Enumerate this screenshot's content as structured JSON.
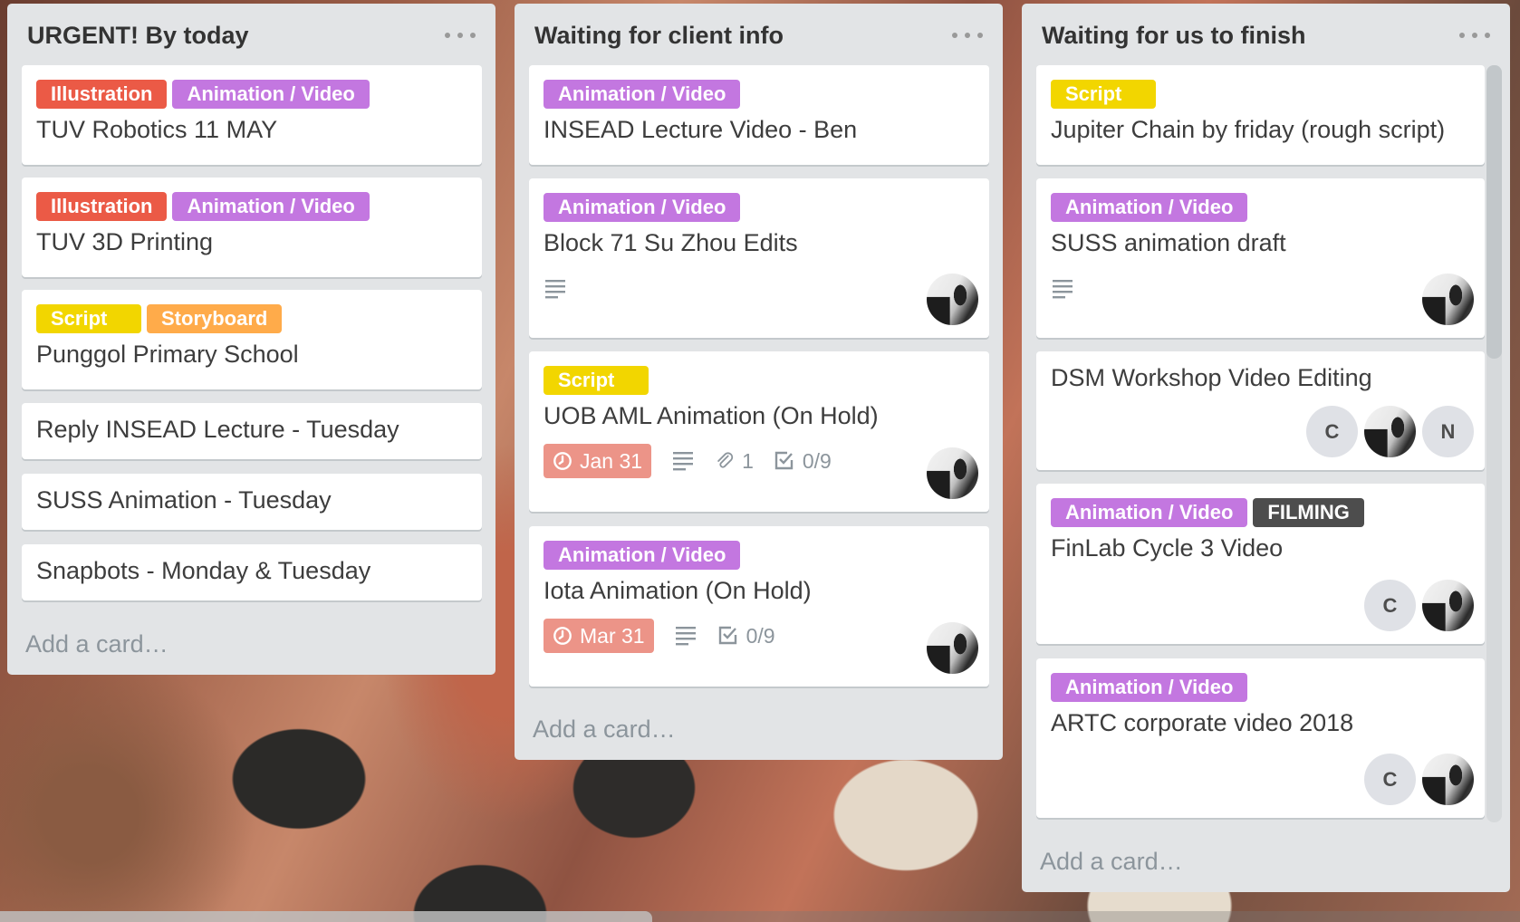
{
  "lists": [
    {
      "title": "URGENT! By today",
      "add_card": "Add a card…",
      "cards": [
        {
          "labels": [
            "Illustration",
            "Animation / Video"
          ],
          "title": "TUV Robotics 11 MAY"
        },
        {
          "labels": [
            "Illustration",
            "Animation / Video"
          ],
          "title": "TUV 3D Printing"
        },
        {
          "labels": [
            "Script",
            "Storyboard"
          ],
          "title": "Punggol Primary School"
        },
        {
          "title": "Reply INSEAD Lecture - Tuesday"
        },
        {
          "title": "SUSS Animation - Tuesday"
        },
        {
          "title": "Snapbots - Monday & Tuesday"
        }
      ]
    },
    {
      "title": "Waiting for client info",
      "add_card": "Add a card…",
      "cards": [
        {
          "labels": [
            "Animation / Video"
          ],
          "title": "INSEAD Lecture Video - Ben"
        },
        {
          "labels": [
            "Animation / Video"
          ],
          "title": "Block 71 Su Zhou Edits",
          "badges": {
            "description": true
          }
        },
        {
          "labels": [
            "Script"
          ],
          "title": "UOB AML Animation (On Hold)",
          "badges": {
            "due": "Jan 31",
            "description": true,
            "attachments": "1",
            "checklist": "0/9"
          }
        },
        {
          "labels": [
            "Animation / Video"
          ],
          "title": "Iota Animation (On Hold)",
          "badges": {
            "due": "Mar 31",
            "description": true,
            "checklist": "0/9"
          }
        }
      ]
    },
    {
      "title": "Waiting for us to finish",
      "add_card": "Add a card…",
      "cards": [
        {
          "labels": [
            "Script"
          ],
          "title": "Jupiter Chain by friday (rough script)"
        },
        {
          "labels": [
            "Animation / Video"
          ],
          "title": "SUSS animation draft",
          "badges": {
            "description": true
          }
        },
        {
          "title": "DSM Workshop Video Editing",
          "members": [
            "C",
            "photo",
            "N"
          ]
        },
        {
          "labels": [
            "Animation / Video",
            "FILMING"
          ],
          "title": "FinLab Cycle 3 Video",
          "members": [
            "C",
            "photo"
          ]
        },
        {
          "labels": [
            "Animation / Video"
          ],
          "title": "ARTC corporate video 2018",
          "members": [
            "C",
            "photo"
          ]
        }
      ]
    }
  ],
  "member_initials": {
    "c": "C",
    "n": "N"
  },
  "label_colors": {
    "Illustration": "#eb5a46",
    "Animation / Video": "#c377e0",
    "Script": "#f2d600",
    "Storyboard": "#ffab4a",
    "FILMING": "#4d4d4d",
    "due_overdue": "#ec9488"
  }
}
